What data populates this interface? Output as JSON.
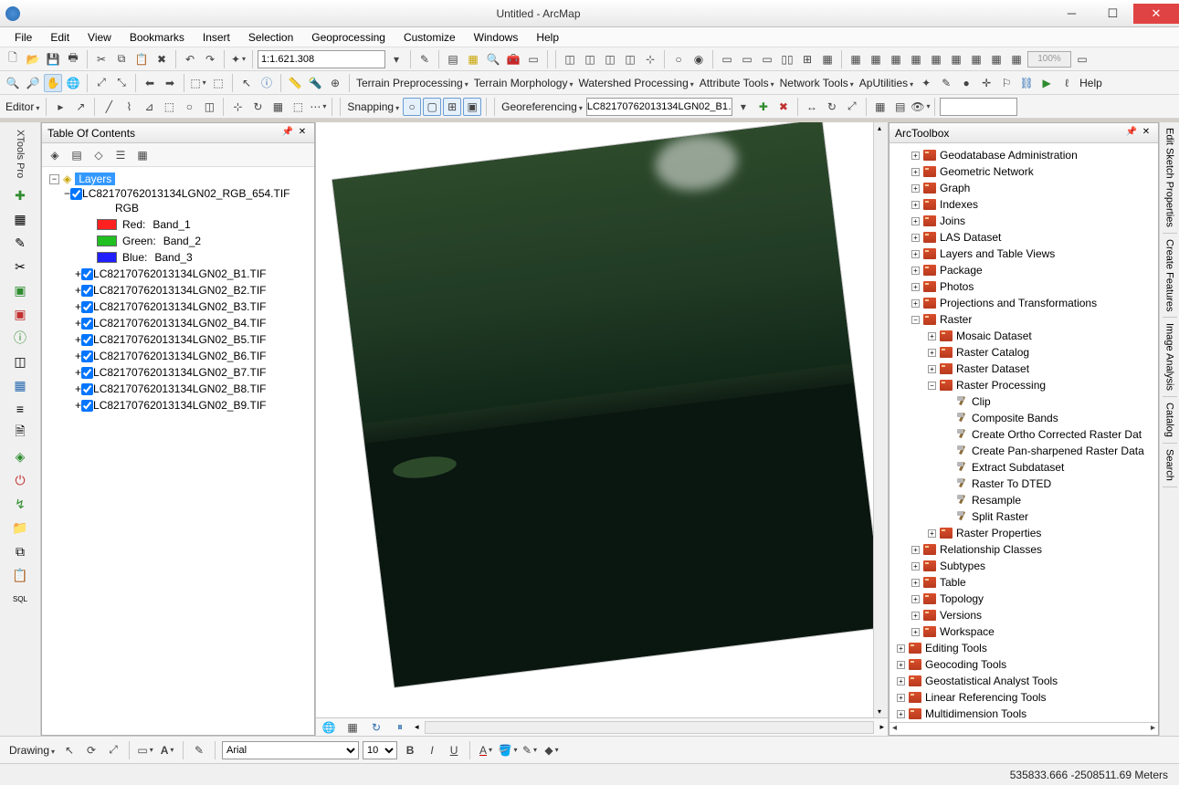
{
  "window": {
    "title": "Untitled - ArcMap"
  },
  "menu": [
    "File",
    "Edit",
    "View",
    "Bookmarks",
    "Insert",
    "Selection",
    "Geoprocessing",
    "Customize",
    "Windows",
    "Help"
  ],
  "standard_tb": {
    "scale": "1:1.621.308",
    "pct": "100%"
  },
  "tb3": {
    "labels": [
      "Terrain Preprocessing",
      "Terrain Morphology",
      "Watershed Processing",
      "Attribute Tools",
      "Network Tools",
      "ApUtilities"
    ],
    "help": "Help"
  },
  "editor": {
    "label": "Editor"
  },
  "snapping": {
    "label": "Snapping"
  },
  "georef": {
    "label": "Georeferencing",
    "layer": "LC82170762013134LGN02_B1…"
  },
  "toc": {
    "title": "Table Of Contents",
    "root": "Layers",
    "rgb_layer": {
      "name": "LC82170762013134LGN02_RGB_654.TIF",
      "sub": "RGB"
    },
    "bands": [
      {
        "color": "#ff2020",
        "label": "Red:",
        "band": "Band_1"
      },
      {
        "color": "#20c020",
        "label": "Green:",
        "band": "Band_2"
      },
      {
        "color": "#2020ff",
        "label": "Blue:",
        "band": "Band_3"
      }
    ],
    "layers": [
      "LC82170762013134LGN02_B1.TIF",
      "LC82170762013134LGN02_B2.TIF",
      "LC82170762013134LGN02_B3.TIF",
      "LC82170762013134LGN02_B4.TIF",
      "LC82170762013134LGN02_B5.TIF",
      "LC82170762013134LGN02_B6.TIF",
      "LC82170762013134LGN02_B7.TIF",
      "LC82170762013134LGN02_B8.TIF",
      "LC82170762013134LGN02_B9.TIF"
    ]
  },
  "toolbox": {
    "title": "ArcToolbox",
    "top_sets": [
      "Geodatabase Administration",
      "Geometric Network",
      "Graph",
      "Indexes",
      "Joins",
      "LAS Dataset",
      "Layers and Table Views",
      "Package",
      "Photos",
      "Projections and Transformations"
    ],
    "raster": "Raster",
    "raster_children": [
      "Mosaic Dataset",
      "Raster Catalog",
      "Raster Dataset"
    ],
    "raster_proc": "Raster Processing",
    "tools": [
      "Clip",
      "Composite Bands",
      "Create Ortho Corrected Raster Dat",
      "Create Pan-sharpened Raster Data",
      "Extract Subdataset",
      "Raster To DTED",
      "Resample",
      "Split Raster"
    ],
    "raster_props": "Raster Properties",
    "bottom_sets": [
      "Relationship Classes",
      "Subtypes",
      "Table",
      "Topology",
      "Versions",
      "Workspace"
    ],
    "root_sets": [
      "Editing Tools",
      "Geocoding Tools",
      "Geostatistical Analyst Tools",
      "Linear Referencing Tools",
      "Multidimension Tools"
    ]
  },
  "right_tabs": [
    "Edit Sketch Properties",
    "Create Features",
    "Image Analysis",
    "Catalog",
    "Search"
  ],
  "left_rail_label": "XTools Pro",
  "drawing": {
    "label": "Drawing",
    "font": "Arial",
    "size": "10"
  },
  "status": {
    "coords": "535833.666 -2508511.69 Meters"
  }
}
